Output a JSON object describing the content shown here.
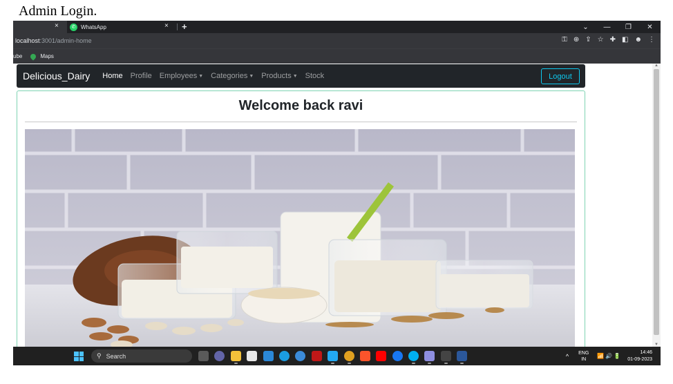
{
  "caption": "Admin Login.",
  "browser": {
    "tabs": [
      {
        "label": ""
      },
      {
        "label": "WhatsApp"
      }
    ],
    "new_tab_symbol": "+",
    "close_symbol": "×",
    "url_host": "localhost",
    "url_path": ":3001/admin-home",
    "bookmarks": [
      {
        "label": "ube"
      },
      {
        "label": "Maps"
      }
    ],
    "window_controls": [
      "⌄",
      "—",
      "❐",
      "✕"
    ],
    "toolbar_icons": [
      "key-icon",
      "zoom-icon",
      "share-icon",
      "star-icon",
      "extensions-icon",
      "sidepanel-icon",
      "profile-icon",
      "menu-icon"
    ]
  },
  "navbar": {
    "brand": "Delicious_Dairy",
    "links": [
      {
        "label": "Home",
        "active": true,
        "dropdown": false
      },
      {
        "label": "Profile",
        "active": false,
        "dropdown": false
      },
      {
        "label": "Employees",
        "active": false,
        "dropdown": true
      },
      {
        "label": "Categories",
        "active": false,
        "dropdown": true
      },
      {
        "label": "Products",
        "active": false,
        "dropdown": true
      },
      {
        "label": "Stock",
        "active": false,
        "dropdown": false
      }
    ],
    "logout_label": "Logout",
    "logout_color": "#0dcaf0",
    "bg_color": "#212529"
  },
  "main": {
    "welcome": "Welcome back ravi",
    "card_border_color": "#7ed3b2"
  },
  "taskbar": {
    "search_placeholder": "Search",
    "lang_top": "ENG",
    "lang_bottom": "IN",
    "time": "14:46",
    "date": "01-09-2023",
    "tray_chevron": "^",
    "sys_icons": "📶🔊🔋",
    "pinned_icons": [
      "task-view-icon",
      "meet-icon",
      "file-explorer-icon",
      "store-icon",
      "pulse-icon",
      "edge-icon",
      "chrome-alt-icon",
      "mcafee-icon",
      "vscode-icon",
      "chrome-icon",
      "brave-icon",
      "youtube-icon",
      "facebook-icon",
      "skype-icon",
      "app-icon",
      "terminal-icon",
      "word-icon"
    ]
  }
}
